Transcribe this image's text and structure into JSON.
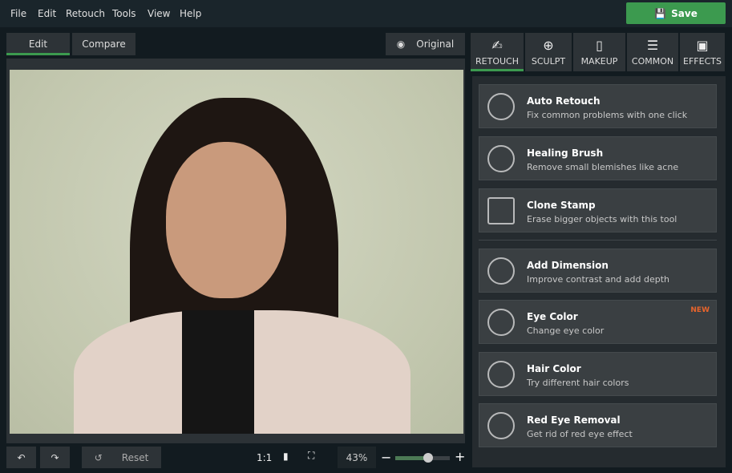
{
  "menu": [
    "File",
    "Edit",
    "Retouch",
    "Tools",
    "View",
    "Help"
  ],
  "save_label": "Save",
  "view_tabs": {
    "edit": "Edit",
    "compare": "Compare",
    "original": "Original"
  },
  "tool_tabs": [
    {
      "label": "RETOUCH",
      "icon": "retouch-icon",
      "active": true
    },
    {
      "label": "SCULPT",
      "icon": "sculpt-icon"
    },
    {
      "label": "MAKEUP",
      "icon": "makeup-icon"
    },
    {
      "label": "COMMON",
      "icon": "sliders-icon"
    },
    {
      "label": "EFFECTS",
      "icon": "effects-icon"
    }
  ],
  "tools": [
    {
      "title": "Auto Retouch",
      "desc": "Fix common problems with one click"
    },
    {
      "title": "Healing Brush",
      "desc": "Remove small blemishes like acne"
    },
    {
      "title": "Clone Stamp",
      "desc": "Erase bigger objects with this tool"
    },
    {
      "title": "Add Dimension",
      "desc": "Improve contrast and add depth"
    },
    {
      "title": "Eye Color",
      "desc": "Change eye color",
      "badge": "NEW"
    },
    {
      "title": "Hair Color",
      "desc": "Try different hair colors"
    },
    {
      "title": "Red Eye Removal",
      "desc": "Get rid of red eye effect"
    }
  ],
  "bottom": {
    "reset": "Reset",
    "ratio": "1:1",
    "zoom": "43%",
    "zoom_slider": 0.6
  },
  "colors": {
    "accent": "#3c9a4f",
    "new_badge": "#e8642c"
  }
}
